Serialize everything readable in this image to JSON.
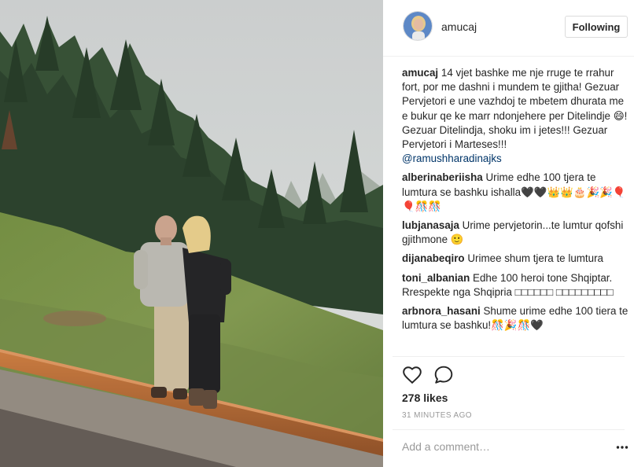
{
  "header": {
    "username": "amucaj",
    "follow_label": "Following"
  },
  "comments": [
    {
      "user": "amucaj",
      "text": "14 vjet bashke me nje rruge te rrahur fort, por me dashni i mundem te gjitha! Gezuar Pervjetori e une vazhdoj te mbetem dhurata me e bukur qe ke marr ndonjehere per Ditelindje 😄! Gezuar Ditelindja, shoku im i jetes!!! Gezuar Pervjetori i Marteses!!!",
      "mention": "@ramushharadinajks"
    },
    {
      "user": "alberinaberiisha",
      "text": "Urime edhe 100 tjera te lumtura se bashku ishalla🖤🖤👑👑🎂🎉🎉🎈🎈🎊🎊"
    },
    {
      "user": "lubjanasaja",
      "text": "Urime pervjetorin...te lumtur qofshi gjithmone 🙂"
    },
    {
      "user": "dijanabeqiro",
      "text": "Urimee shum tjera te lumtura"
    },
    {
      "user": "toni_albanian",
      "text": "Edhe 100 heroi tone Shqiptar. Rrespekte nga Shqipria □□□□□□ □□□□□□□□□"
    },
    {
      "user": "arbnora_hasani",
      "text": "Shume urime edhe 100 tiera te lumtura se bashku!🎊🎉🎊🖤"
    }
  ],
  "icons": {
    "like": "heart-icon",
    "comment": "speech-bubble-icon",
    "more": "ellipsis-icon"
  },
  "stats": {
    "likes": "278 likes",
    "time_ago": "31 MINUTES AGO"
  },
  "input": {
    "placeholder": "Add a comment…"
  },
  "colors": {
    "accent_link": "#003569",
    "text": "#262626",
    "muted": "#999999",
    "border": "#dbdbdb"
  }
}
